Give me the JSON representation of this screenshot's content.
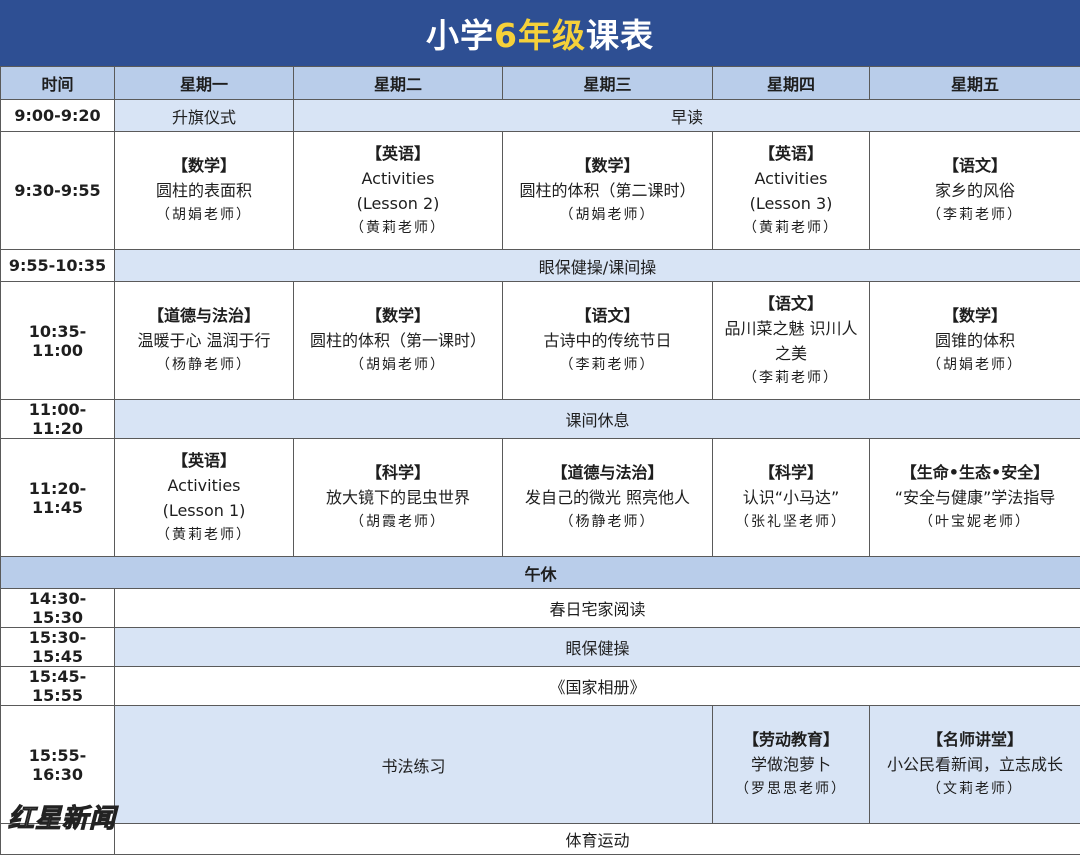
{
  "title": {
    "prefix": "小学",
    "grade": "6年级",
    "suffix": "课表"
  },
  "header": [
    "时间",
    "星期一",
    "星期二",
    "星期三",
    "星期四",
    "星期五"
  ],
  "rows": {
    "r1": {
      "time": "9:00-9:20",
      "mon": "升旗仪式",
      "rest": "早读"
    },
    "r2": {
      "time": "9:30-9:55",
      "cells": [
        {
          "subject": "【数学】",
          "topic": [
            "圆柱的表面积"
          ],
          "teacher": "（胡娟老师）"
        },
        {
          "subject": "【英语】",
          "topic": [
            "Activities",
            "(Lesson 2)"
          ],
          "teacher": "（黄莉老师）"
        },
        {
          "subject": "【数学】",
          "topic": [
            "圆柱的体积（第二课时）"
          ],
          "teacher": "（胡娟老师）"
        },
        {
          "subject": "【英语】",
          "topic": [
            "Activities",
            "(Lesson 3)"
          ],
          "teacher": "（黄莉老师）"
        },
        {
          "subject": "【语文】",
          "topic": [
            "家乡的风俗"
          ],
          "teacher": "（李莉老师）"
        }
      ]
    },
    "r3": {
      "time": "9:55-10:35",
      "text": "眼保健操/课间操"
    },
    "r4": {
      "time": "10:35-11:00",
      "cells": [
        {
          "subject": "【道德与法治】",
          "topic": [
            "温暖于心 温润于行"
          ],
          "teacher": "（杨静老师）"
        },
        {
          "subject": "【数学】",
          "topic": [
            "圆柱的体积（第一课时）"
          ],
          "teacher": "（胡娟老师）"
        },
        {
          "subject": "【语文】",
          "topic": [
            "古诗中的传统节日"
          ],
          "teacher": "（李莉老师）"
        },
        {
          "subject": "【语文】",
          "topic": [
            "品川菜之魅 识川人",
            "之美"
          ],
          "teacher": "（李莉老师）"
        },
        {
          "subject": "【数学】",
          "topic": [
            "圆锥的体积"
          ],
          "teacher": "（胡娟老师）"
        }
      ]
    },
    "r5": {
      "time": "11:00-11:20",
      "text": "课间休息"
    },
    "r6": {
      "time": "11:20-11:45",
      "cells": [
        {
          "subject": "【英语】",
          "topic": [
            "Activities",
            "(Lesson 1)"
          ],
          "teacher": "（黄莉老师）"
        },
        {
          "subject": "【科学】",
          "topic": [
            "放大镜下的昆虫世界"
          ],
          "teacher": "（胡霞老师）"
        },
        {
          "subject": "【道德与法治】",
          "topic": [
            "发自己的微光 照亮他人"
          ],
          "teacher": "（杨静老师）"
        },
        {
          "subject": "【科学】",
          "topic": [
            "认识“小马达”"
          ],
          "teacher": "（张礼坚老师）"
        },
        {
          "subject": "【生命•生态•安全】",
          "topic": [
            "“安全与健康”学法指导"
          ],
          "teacher": "（叶宝妮老师）"
        }
      ]
    },
    "lunch": "午休",
    "r7": {
      "time": "14:30-15:30",
      "text": "春日宅家阅读"
    },
    "r8": {
      "time": "15:30-15:45",
      "text": "眼保健操"
    },
    "r9": {
      "time": "15:45-15:55",
      "text": "《国家相册》"
    },
    "r10": {
      "time": "15:55-16:30",
      "span": "书法练习",
      "thu": {
        "subject": "【劳动教育】",
        "topic": [
          "学做泡萝卜"
        ],
        "teacher": "（罗思思老师）"
      },
      "fri": {
        "subject": "【名师讲堂】",
        "topic": [
          "小公民看新闻，立志成长"
        ],
        "teacher": "（文莉老师）"
      }
    },
    "r11": {
      "text": "体育运动"
    }
  },
  "watermark": "红星新闻",
  "colors": {
    "title_bg": "#2e4f93",
    "grade_accent": "#f6d13a",
    "header_bg": "#b9cdea",
    "band_bg": "#d8e4f5",
    "border": "#5a5a5a"
  }
}
